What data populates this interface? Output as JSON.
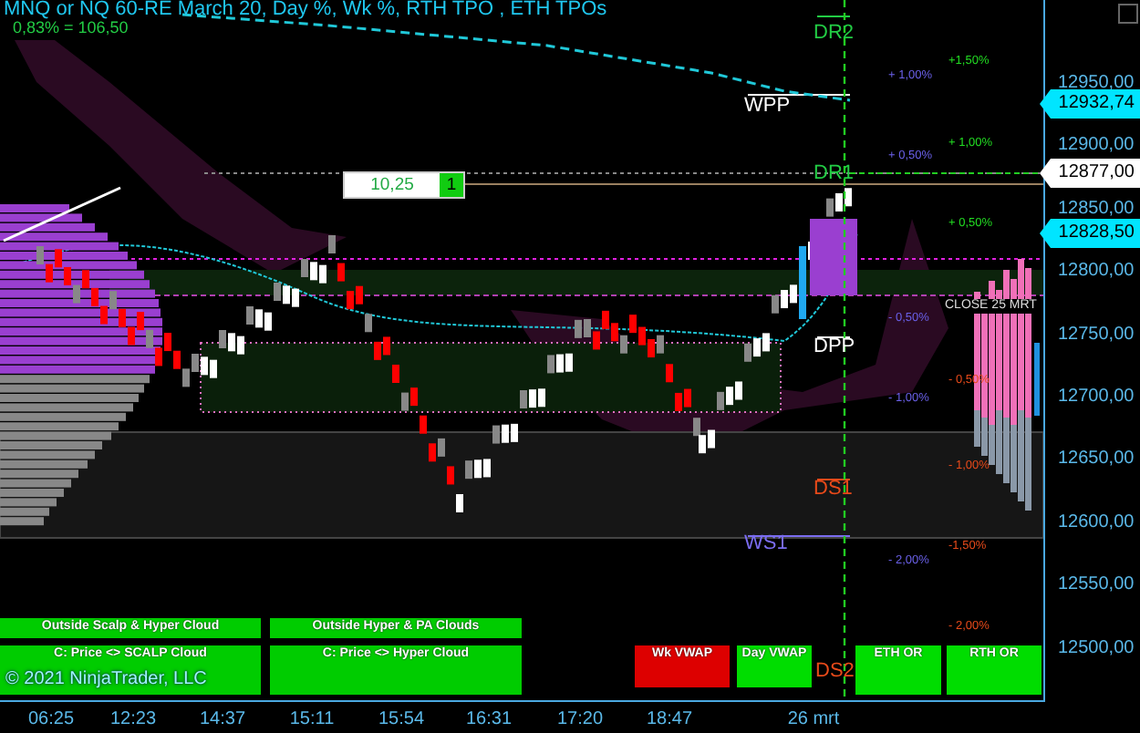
{
  "chart_title": "MNQ or NQ 60-RE March 20, Day %, Wk %, RTH TPO , ETH TPOs",
  "day_change": "0,83% = 106,50",
  "range_box": {
    "value": "10,25",
    "count": "1"
  },
  "pivot_levels": [
    {
      "label": "DR2",
      "color": "#22cc44"
    },
    {
      "label": "WPP",
      "color": "#ffffff"
    },
    {
      "label": "DR1",
      "color": "#22cc44"
    },
    {
      "label": "DPP",
      "color": "#ffffff"
    },
    {
      "label": "DS1",
      "color": "#e84a1a"
    },
    {
      "label": "WS1",
      "color": "#7a6cf0"
    },
    {
      "label": "DS2",
      "color": "#e84a1a"
    }
  ],
  "percent_levels": [
    {
      "label": "+1,50%",
      "color": "#22dd22"
    },
    {
      "label": "+ 1,00%",
      "color": "#6a60e8"
    },
    {
      "label": "+ 1,00%",
      "color": "#22dd22"
    },
    {
      "label": "+ 0,50%",
      "color": "#6a60e8"
    },
    {
      "label": "+ 0,50%",
      "color": "#22dd22"
    },
    {
      "label": "- 0,50%",
      "color": "#6a60e8"
    },
    {
      "label": "- 0,50%",
      "color": "#e84a1a"
    },
    {
      "label": "- 1,00%",
      "color": "#6a60e8"
    },
    {
      "label": "- 1,00%",
      "color": "#e84a1a"
    },
    {
      "label": "-1,50%",
      "color": "#e84a1a"
    },
    {
      "label": "- 2,00%",
      "color": "#6a60e8"
    },
    {
      "label": "- 2,00%",
      "color": "#e84a1a"
    }
  ],
  "close_label": "CLOSE 25 MRT",
  "price_tags": [
    {
      "value": "12932,74",
      "color": "#00e5ff"
    },
    {
      "value": "12877,00",
      "color": "#ffffff"
    },
    {
      "value": "12828,50",
      "color": "#00e5ff"
    }
  ],
  "y_axis": {
    "ticks": [
      "12950,00",
      "12900,00",
      "12850,00",
      "12800,00",
      "12750,00",
      "12700,00",
      "12650,00",
      "12600,00",
      "12550,00",
      "12500,00"
    ]
  },
  "x_axis": {
    "ticks": [
      "06:25",
      "12:23",
      "14:37",
      "15:11",
      "15:54",
      "16:31",
      "17:20",
      "18:47",
      "26 mrt"
    ]
  },
  "signal_buttons": [
    {
      "label": "Outside Scalp & Hyper Cloud",
      "color": "#00cc00"
    },
    {
      "label": "Outside Hyper & PA Clouds",
      "color": "#00cc00"
    },
    {
      "label": "C: Price <> SCALP Cloud",
      "color": "#00cc00"
    },
    {
      "label": "C: Price <> Hyper Cloud",
      "color": "#00cc00"
    },
    {
      "label": "Wk VWAP",
      "color": "#dd0000"
    },
    {
      "label": "Day VWAP",
      "color": "#00dd00"
    },
    {
      "label": "ETH OR",
      "color": "#00dd00"
    },
    {
      "label": "RTH OR",
      "color": "#00dd00"
    }
  ],
  "copyright": "© 2021 NinjaTrader, LLC"
}
